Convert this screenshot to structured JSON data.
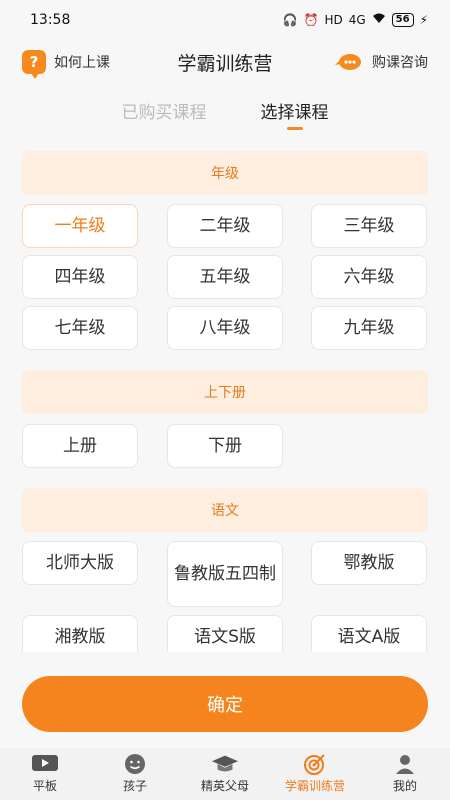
{
  "status_bar": {
    "time": "13:58",
    "network": "HD",
    "signal": "4G",
    "battery": "56"
  },
  "header": {
    "left_label": "如何上课",
    "title": "学霸训练营",
    "right_label": "购课咨询",
    "left_icon": "question-icon",
    "right_icon": "chat-icon"
  },
  "tabs": [
    {
      "label": "已购买课程",
      "active": false
    },
    {
      "label": "选择课程",
      "active": true
    }
  ],
  "sections": {
    "grade": {
      "title": "年级",
      "options": [
        "一年级",
        "二年级",
        "三年级",
        "四年级",
        "五年级",
        "六年级",
        "七年级",
        "八年级",
        "九年级"
      ],
      "selected": "一年级"
    },
    "volume": {
      "title": "上下册",
      "options": [
        "上册",
        "下册"
      ]
    },
    "chinese": {
      "title": "语文",
      "options": [
        "北师大版",
        "鲁教版五四制",
        "鄂教版",
        "湘教版",
        "语文S版",
        "语文A版"
      ]
    }
  },
  "confirm_label": "确定",
  "bottom_nav": [
    {
      "label": "平板",
      "icon": "play-icon",
      "active": false
    },
    {
      "label": "孩子",
      "icon": "face-icon",
      "active": false
    },
    {
      "label": "精英父母",
      "icon": "graduation-cap-icon",
      "active": false
    },
    {
      "label": "学霸训练营",
      "icon": "target-icon",
      "active": true
    },
    {
      "label": "我的",
      "icon": "person-icon",
      "active": false
    }
  ],
  "colors": {
    "accent": "#f5841e",
    "section_bg": "#fdeee0",
    "page_bg": "#f7f7f7"
  }
}
